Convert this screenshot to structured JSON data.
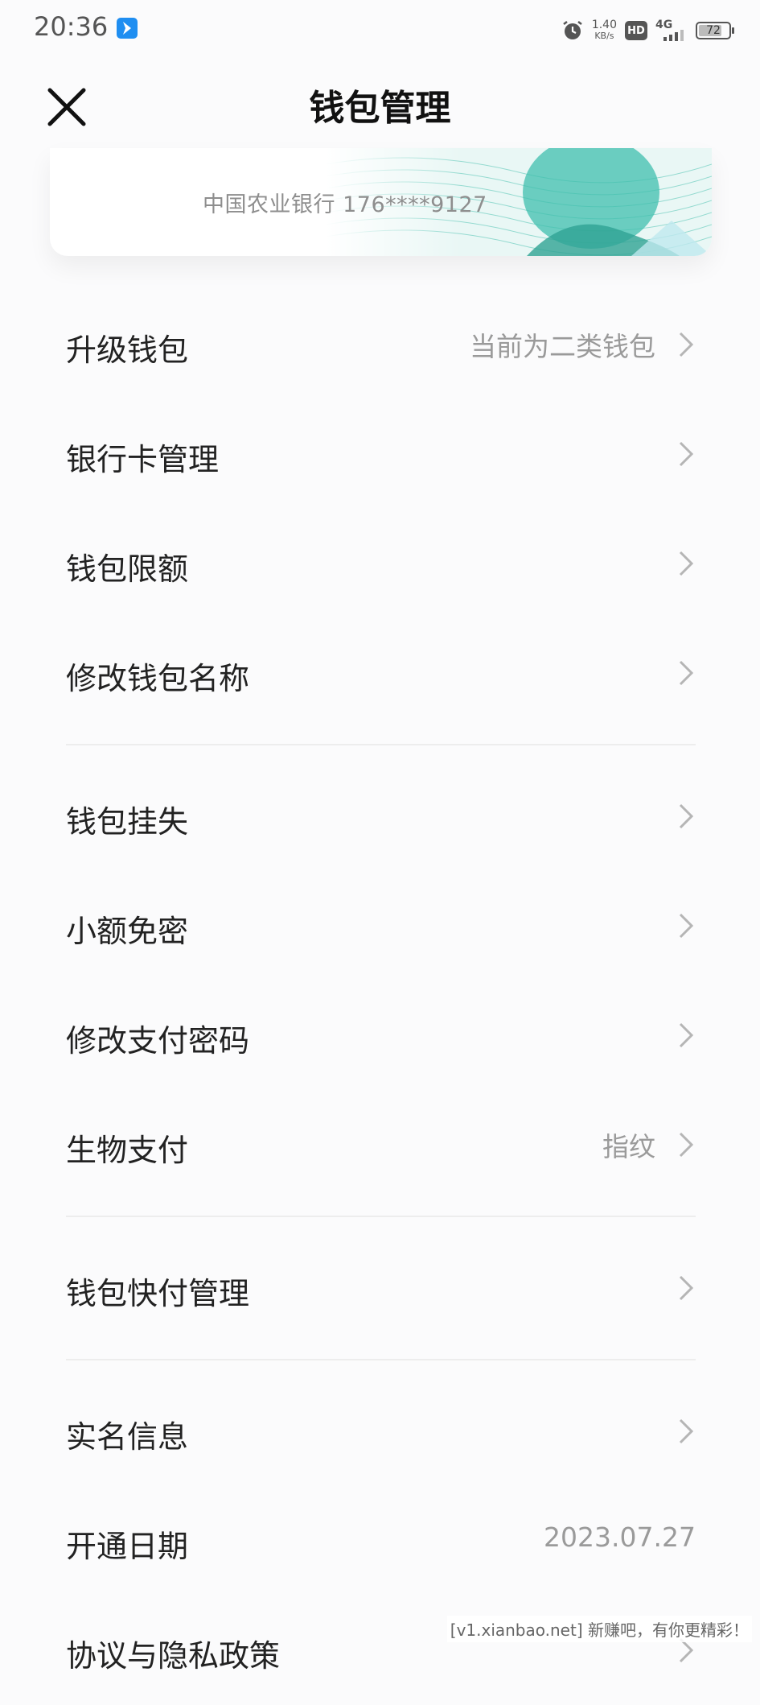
{
  "status_bar": {
    "time": "20:36",
    "net_speed_value": "1.40",
    "net_speed_unit": "KB/s",
    "hd": "HD",
    "network": "4G",
    "battery": "72"
  },
  "nav": {
    "title": "钱包管理",
    "close_icon": "close-icon"
  },
  "card": {
    "text": "中国农业银行 176****9127"
  },
  "menu": {
    "group1": [
      {
        "label": "升级钱包",
        "value": "当前为二类钱包"
      },
      {
        "label": "银行卡管理"
      },
      {
        "label": "钱包限额"
      },
      {
        "label": "修改钱包名称"
      }
    ],
    "group2": [
      {
        "label": "钱包挂失"
      },
      {
        "label": "小额免密"
      },
      {
        "label": "修改支付密码"
      },
      {
        "label": "生物支付",
        "value": "指纹"
      }
    ],
    "group3": [
      {
        "label": "钱包快付管理"
      }
    ],
    "group4": [
      {
        "label": "实名信息"
      },
      {
        "label": "开通日期",
        "value": "2023.07.27"
      },
      {
        "label": "协议与隐私政策"
      }
    ]
  },
  "watermark": "[v1.xianbao.net] 新赚吧，有你更精彩！",
  "colors": {
    "accent_blue": "#1f8ef1",
    "card_pattern": "#3fbfae"
  }
}
